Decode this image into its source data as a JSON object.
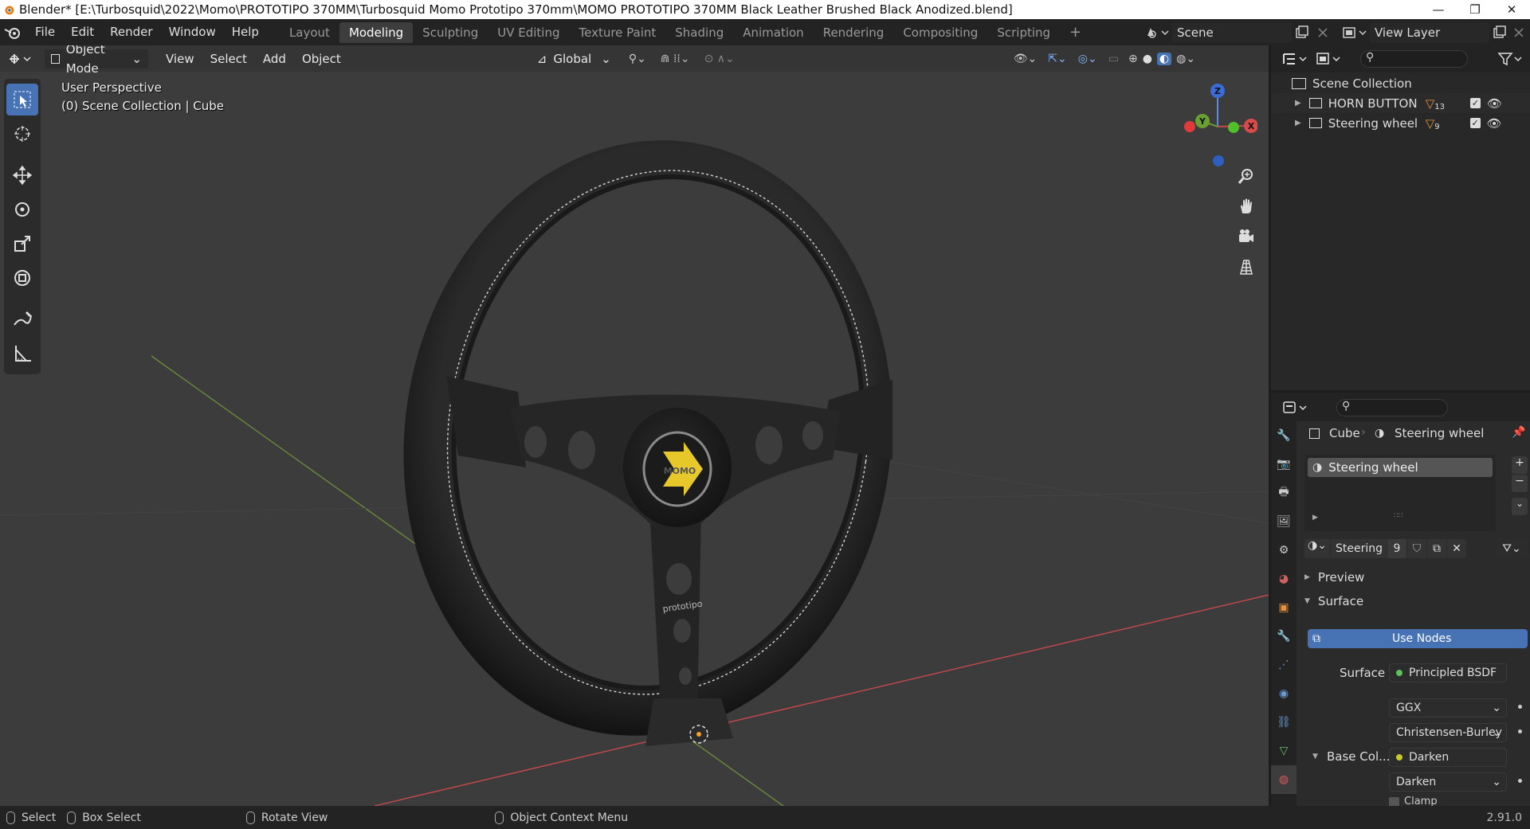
{
  "window": {
    "title": "Blender* [E:\\Turbosquid\\2022\\Momo\\PROTOTIPO 370MM\\Turbosquid Momo Prototipo 370mm\\MOMO PROTOTIPO 370MM Black Leather Brushed Black Anodized.blend]",
    "minimize": "—",
    "maximize": "❐",
    "close": "✕"
  },
  "menus": [
    "File",
    "Edit",
    "Render",
    "Window",
    "Help"
  ],
  "workspaces": [
    {
      "label": "Layout",
      "active": false
    },
    {
      "label": "Modeling",
      "active": true
    },
    {
      "label": "Sculpting",
      "active": false
    },
    {
      "label": "UV Editing",
      "active": false
    },
    {
      "label": "Texture Paint",
      "active": false
    },
    {
      "label": "Shading",
      "active": false
    },
    {
      "label": "Animation",
      "active": false
    },
    {
      "label": "Rendering",
      "active": false
    },
    {
      "label": "Compositing",
      "active": false
    },
    {
      "label": "Scripting",
      "active": false
    }
  ],
  "add_workspace": "+",
  "scene": {
    "value": "Scene"
  },
  "view_layer": {
    "value": "View Layer"
  },
  "viewport": {
    "mode": "Object Mode",
    "menus": [
      "View",
      "Select",
      "Add",
      "Object"
    ],
    "orientation": "Global",
    "perspective": "User Perspective",
    "context": "(0) Scene Collection | Cube",
    "gizmo": {
      "z": "Z",
      "y": "Y",
      "x": "X"
    },
    "horn_logo": "MOMO",
    "spoke_logo": "prototipo"
  },
  "outliner": {
    "root": "Scene Collection",
    "items": [
      {
        "label": "HORN BUTTON",
        "count": "13"
      },
      {
        "label": "Steering wheel",
        "count": "9"
      }
    ]
  },
  "properties": {
    "breadcrumb_object": "Cube",
    "breadcrumb_material": "Steering wheel",
    "slot": "Steering wheel",
    "material_name": "Steering ...",
    "user_count": "9",
    "preview": "Preview",
    "surface_panel": "Surface",
    "use_nodes": "Use Nodes",
    "surface_label": "Surface",
    "surface_value": "Principled BSDF",
    "distribution": "GGX",
    "subsurface": "Christensen-Burley",
    "base_color_label": "Base Col...",
    "base_color_value": "Darken",
    "blend": "Darken",
    "clamp": "Clamp"
  },
  "statusbar": {
    "select": "Select",
    "box_select": "Box Select",
    "rotate": "Rotate View",
    "context_menu": "Object Context Menu",
    "version": "2.91.0"
  },
  "colors": {
    "accent": "#4772b3",
    "viewport_bg": "#3c3c3c",
    "x_axis": "#c94a4a",
    "y_axis": "#6a8a3a"
  }
}
